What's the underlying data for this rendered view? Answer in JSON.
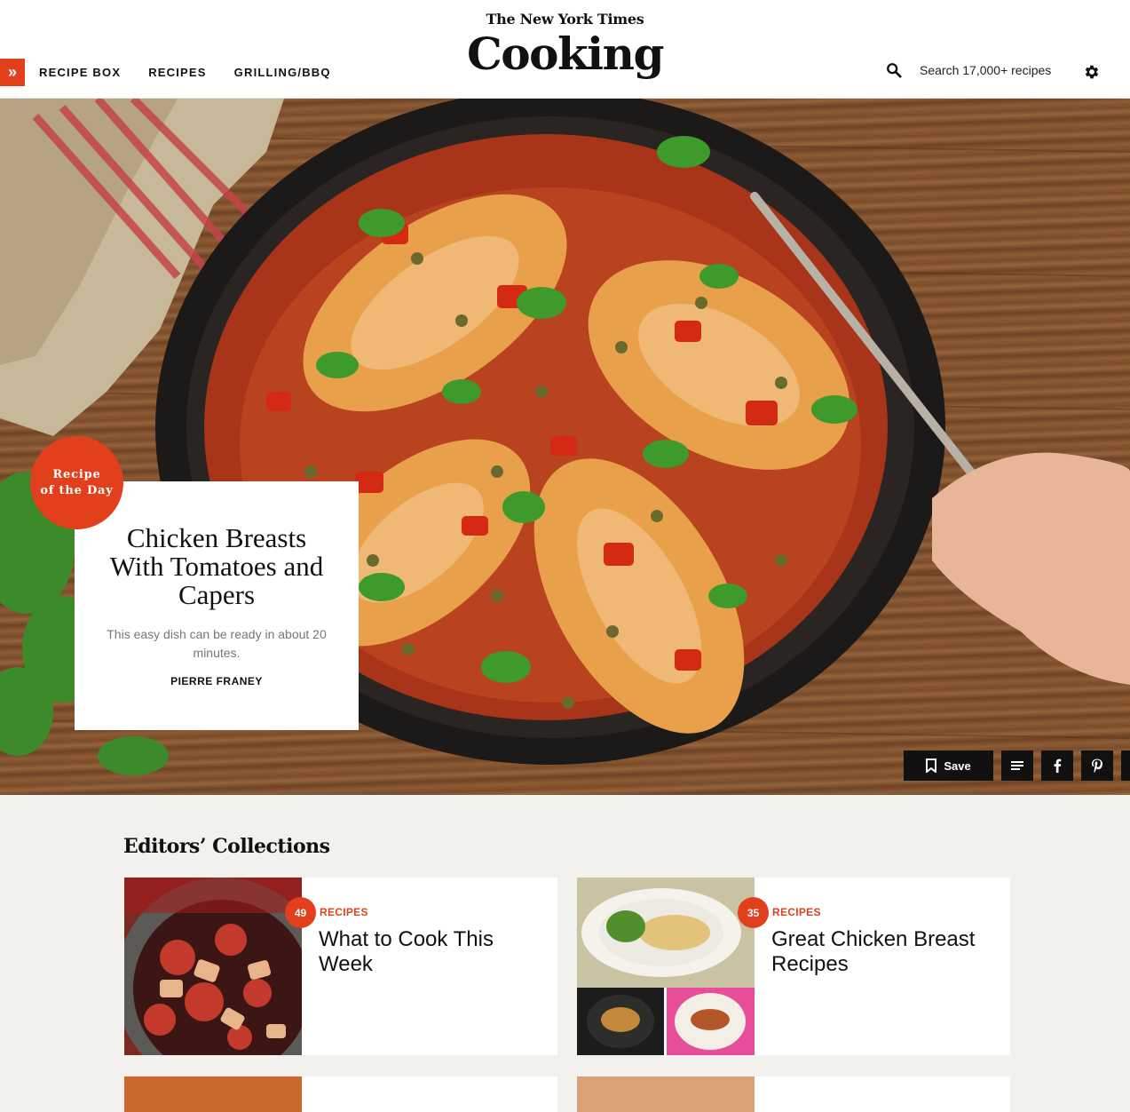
{
  "header": {
    "nyt_logo": "The New York Times",
    "cooking_logo": "Cooking",
    "nav": [
      "RECIPE BOX",
      "RECIPES",
      "GRILLING/BBQ"
    ],
    "search_placeholder": "Search 17,000+ recipes"
  },
  "hero": {
    "badge_line1": "Recipe",
    "badge_line2": "of the Day",
    "title": "Chicken Breasts With Tomatoes and Capers",
    "description": "This easy dish can be ready in about 20 minutes.",
    "author": "PIERRE FRANEY",
    "actions": {
      "save_label": "Save"
    }
  },
  "collections": {
    "title": "Editors’ Collections",
    "items": [
      {
        "count": "49",
        "kicker": "RECIPES",
        "title": "What to Cook This Week"
      },
      {
        "count": "35",
        "kicker": "RECIPES",
        "title": "Great Chicken Breast Recipes"
      }
    ]
  },
  "colors": {
    "accent": "#e2401c",
    "text": "#111111",
    "page_bg": "#f2f1ee"
  },
  "icons": [
    "chevron-double-right-icon",
    "search-icon",
    "gear-icon",
    "bookmark-icon",
    "list-icon",
    "facebook-icon",
    "pinterest-icon",
    "share-icon"
  ]
}
